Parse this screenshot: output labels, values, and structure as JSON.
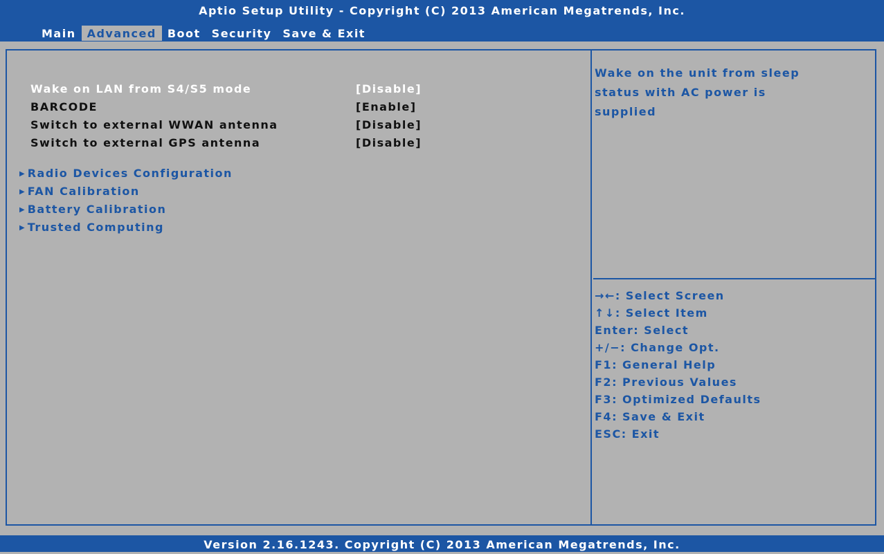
{
  "header": {
    "title": "Aptio Setup Utility - Copyright (C) 2013 American Megatrends, Inc.",
    "tabs": [
      {
        "label": "Main"
      },
      {
        "label": "Advanced"
      },
      {
        "label": "Boot"
      },
      {
        "label": "Security"
      },
      {
        "label": "Save & Exit"
      }
    ],
    "active_tab": "Advanced"
  },
  "settings": [
    {
      "label": "Wake on LAN from S4/S5 mode",
      "value": "[Disable]",
      "selected": true
    },
    {
      "label": "BARCODE",
      "value": "[Enable]"
    },
    {
      "label": "Switch to external WWAN antenna",
      "value": "[Disable]"
    },
    {
      "label": "Switch to external GPS antenna",
      "value": "[Disable]"
    }
  ],
  "submenus": [
    {
      "label": "Radio Devices Configuration",
      "icon": "triangle-right-icon"
    },
    {
      "label": "FAN Calibration",
      "icon": "triangle-right-icon"
    },
    {
      "label": "Battery Calibration",
      "icon": "triangle-right-icon"
    },
    {
      "label": "Trusted Computing",
      "icon": "triangle-right-icon"
    }
  ],
  "help": {
    "lines": [
      "Wake on the unit from sleep",
      "status with AC power is",
      "supplied"
    ]
  },
  "keys": [
    "→←: Select Screen",
    "↑↓: Select Item",
    "Enter: Select",
    "+/−: Change Opt.",
    "F1: General Help",
    "F2: Previous Values",
    "F3: Optimized Defaults",
    "F4: Save & Exit",
    "ESC: Exit"
  ],
  "footer": {
    "text": "Version 2.16.1243. Copyright (C) 2013 American Megatrends, Inc."
  },
  "colors": {
    "accent": "#1c56a4",
    "background": "#b2b2b2",
    "selected_text": "#ffffff",
    "normal_text": "#111111"
  }
}
